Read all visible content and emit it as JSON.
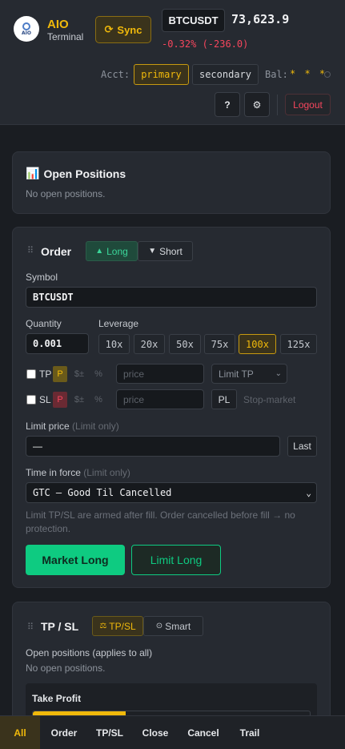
{
  "header": {
    "brand": "AIO",
    "brand_sub": "Terminal",
    "logo_text": "AIO",
    "sync_icon": "⟳",
    "sync_label": "Sync",
    "symbol": "BTCUSDT",
    "price": "73,623.9",
    "change": "-0.32% (-236.0)",
    "acct_label": "Acct:",
    "accounts": [
      "primary",
      "secondary"
    ],
    "bal_label": "Bal:",
    "bal_value": "* * *",
    "help_label": "?",
    "settings_icon": "⚙",
    "logout_label": "Logout"
  },
  "open_positions": {
    "icon": "📊",
    "title": "Open Positions",
    "empty": "No open positions."
  },
  "order": {
    "title": "Order",
    "side_tabs": [
      {
        "icon": "▲",
        "label": "Long"
      },
      {
        "icon": "▼",
        "label": "Short"
      }
    ],
    "symbol_label": "Symbol",
    "symbol_value": "BTCUSDT",
    "quantity_label": "Quantity",
    "quantity_value": "0.001",
    "leverage_label": "Leverage",
    "leverage_options": [
      "10x",
      "20x",
      "50x",
      "75x",
      "100x",
      "125x"
    ],
    "leverage_selected": "100x",
    "tp": {
      "label": "TP",
      "p": "P",
      "dollar": "$±",
      "pct": "%",
      "placeholder": "price",
      "type": "Limit TP"
    },
    "sl": {
      "label": "SL",
      "p": "P",
      "dollar": "$±",
      "pct": "%",
      "placeholder": "price",
      "pl_btn": "PL",
      "type": "Stop-market"
    },
    "limit_price_label": "Limit price",
    "limit_price_hint": "(Limit only)",
    "limit_price_value": "—",
    "last_btn": "Last",
    "tif_label": "Time in force",
    "tif_hint": "(Limit only)",
    "tif_value": "GTC — Good Til Cancelled",
    "note": "Limit TP/SL are armed after fill. Order cancelled before fill → no protection.",
    "market_btn": "Market Long",
    "limit_btn": "Limit Long"
  },
  "tpsl": {
    "title": "TP / SL",
    "tabs": [
      {
        "icon": "⚖",
        "label": "TP/SL"
      },
      {
        "icon": "⊙",
        "label": "Smart"
      }
    ],
    "scope_label": "Open positions (applies to all)",
    "empty": "No open positions.",
    "take_profit_label": "Take Profit"
  },
  "bottom_nav": [
    "All",
    "Order",
    "TP/SL",
    "Close",
    "Cancel",
    "Trail"
  ],
  "colors": {
    "accent": "#f0b90b",
    "up": "#0ecb81",
    "down": "#f6465d",
    "background": "#1a1d22",
    "card": "#262a31"
  }
}
